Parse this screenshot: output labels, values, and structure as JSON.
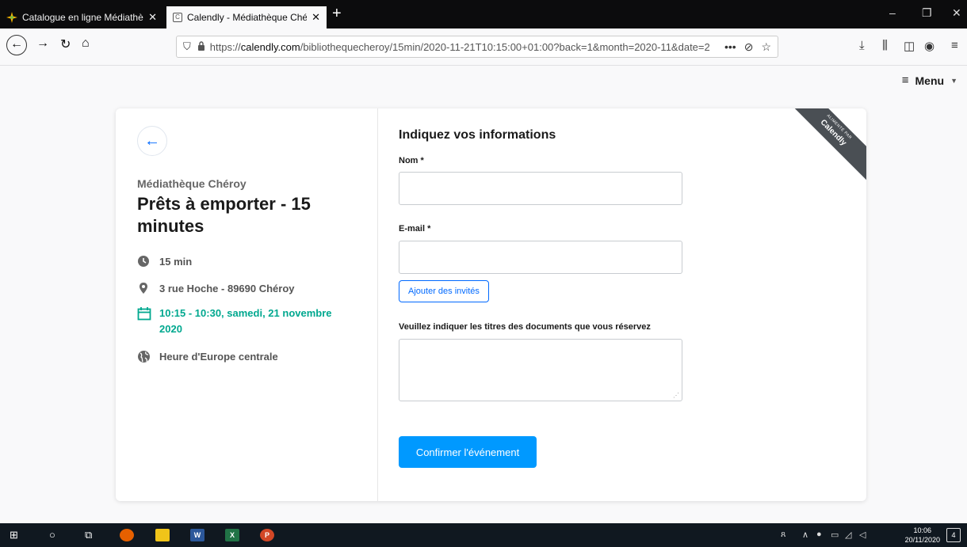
{
  "browser": {
    "tabs": [
      {
        "title": "Catalogue en ligne Médiathèque",
        "active": false
      },
      {
        "title": "Calendly - Médiathèque Chéroy",
        "active": true
      }
    ],
    "url_prefix": "https://",
    "url_domain": "calendly.com",
    "url_rest": "/bibliothequecheroy/15min/2020-11-21T10:15:00+01:00?back=1&month=2020-11&date=2",
    "url_more": "•••"
  },
  "page": {
    "menu_label": "Menu"
  },
  "event": {
    "organizer": "Médiathèque Chéroy",
    "title": "Prêts à emporter - 15 minutes",
    "duration": "15 min",
    "location": "3 rue Hoche - 89690 Chéroy",
    "datetime": "10:15 - 10:30, samedi, 21 novembre 2020",
    "timezone": "Heure d'Europe centrale"
  },
  "form": {
    "heading": "Indiquez vos informations",
    "name_label": "Nom *",
    "name_value": "",
    "email_label": "E-mail *",
    "email_value": "",
    "add_guests_label": "Ajouter des invités",
    "docs_label": "Veuillez indiquer les titres des documents que vous réservez",
    "docs_value": "",
    "confirm_label": "Confirmer l'événement"
  },
  "ribbon": {
    "small": "ALIMENTÉ PAR",
    "brand": "Calendly"
  },
  "taskbar": {
    "time": "10:06",
    "date": "20/11/2020",
    "notifications": "4"
  },
  "colors": {
    "accent": "#0069ff",
    "confirm_button": "#0099ff",
    "date_green": "#00a88f"
  }
}
